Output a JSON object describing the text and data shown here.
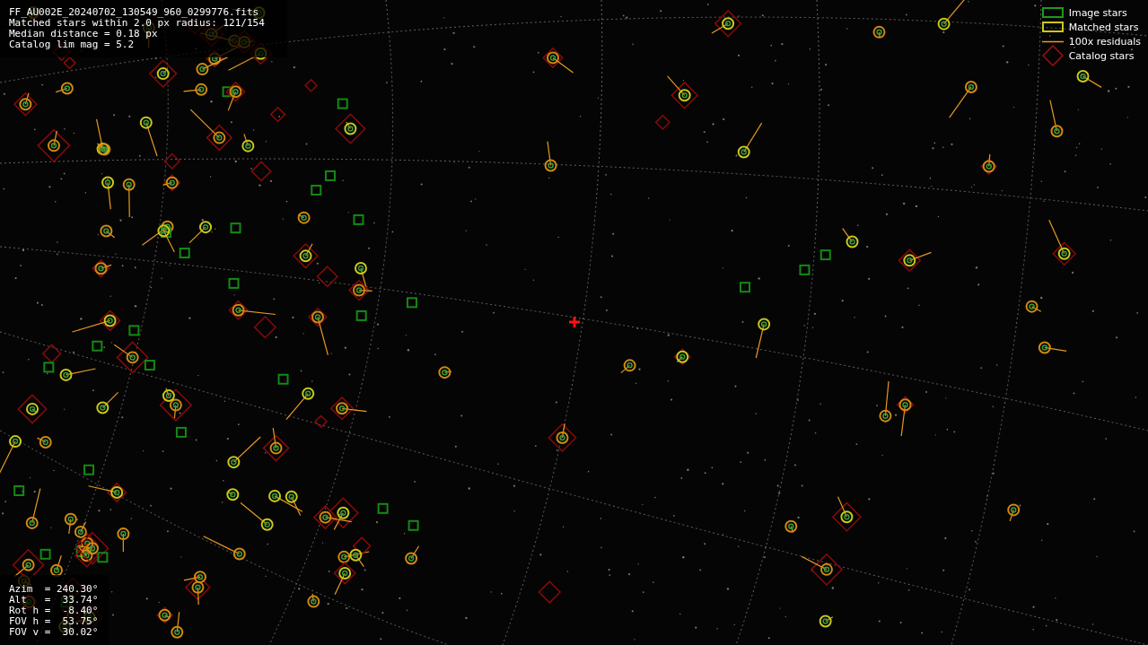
{
  "info": {
    "lines": [
      "FF_AU002E_20240702_130549_960_0299776.fits",
      "Matched stars within 2.0 px radius: 121/154",
      "Median distance = 0.18 px",
      "Catalog lim mag = 5.2"
    ]
  },
  "legend": [
    {
      "kind": "image",
      "label": "Image stars"
    },
    {
      "kind": "matched",
      "label": "Matched stars"
    },
    {
      "kind": "residual",
      "label": "100x residuals"
    },
    {
      "kind": "catalog",
      "label": "Catalog stars"
    }
  ],
  "pointing": {
    "lines": [
      "Azim  = 240.30°",
      "Alt   =  33.74°",
      "Rot h =  -8.40°",
      "FOV h =  53.75°",
      "FOV v =  30.02°"
    ]
  }
}
